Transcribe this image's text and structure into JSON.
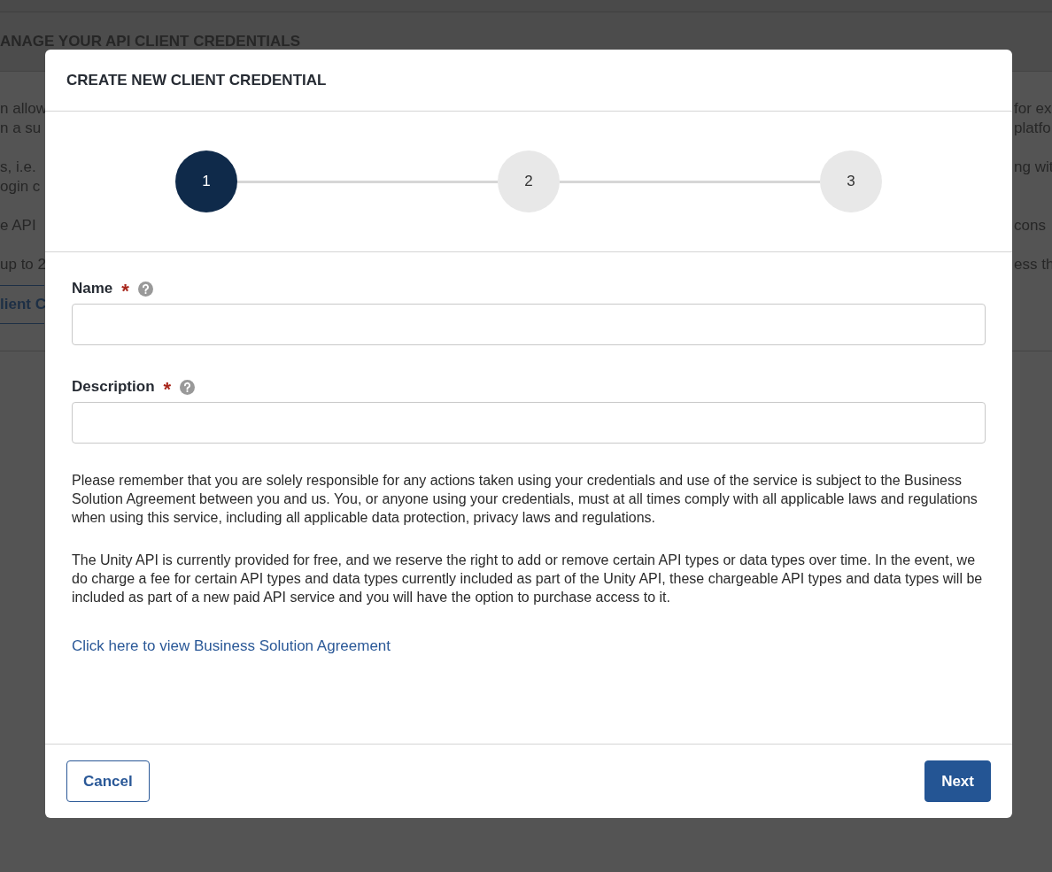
{
  "background_page": {
    "title": "ANAGE YOUR API CLIENT CREDENTIALS",
    "left_fragments": [
      [
        "n allow",
        "n a su"
      ],
      [
        "s, i.e. ",
        "ogin c"
      ],
      [
        "e API"
      ],
      [
        "up to 2"
      ]
    ],
    "right_fragments": [
      [
        "for ex",
        "platfo"
      ],
      [
        "ng wit"
      ],
      [
        "cons"
      ],
      [
        "ess th"
      ]
    ],
    "button_fragment": "lient C"
  },
  "dialog": {
    "title": "CREATE NEW CLIENT CREDENTIAL",
    "steps": [
      {
        "label": "1",
        "selected": true
      },
      {
        "label": "2",
        "selected": false
      },
      {
        "label": "3",
        "selected": false
      }
    ],
    "fields": [
      {
        "label": "Name",
        "required": true,
        "required_mark": "*"
      },
      {
        "label": "Description",
        "required": true,
        "required_mark": "*"
      }
    ],
    "paragraphs": [
      "Please remember that you are solely responsible for any actions taken using your credentials and use of the service is subject to the Business Solution Agreement between you and us. You, or anyone using your credentials, must at all times comply with all applicable laws and regulations when using this service, including all applicable data protection, privacy laws and regulations.",
      "The Unity API is currently provided for free, and we reserve the right to add or remove certain API types or data types over time. In the event, we do charge a fee for certain API types and data types currently included as part of the Unity API, these chargeable API types and data types will be included as part of a new paid API service and you will have the option to purchase access to it."
    ],
    "link": "Click here to view Business Solution Agreement",
    "buttons": [
      {
        "label": "Cancel",
        "kind": "secondary"
      },
      {
        "label": "Next",
        "kind": "primary"
      }
    ]
  }
}
